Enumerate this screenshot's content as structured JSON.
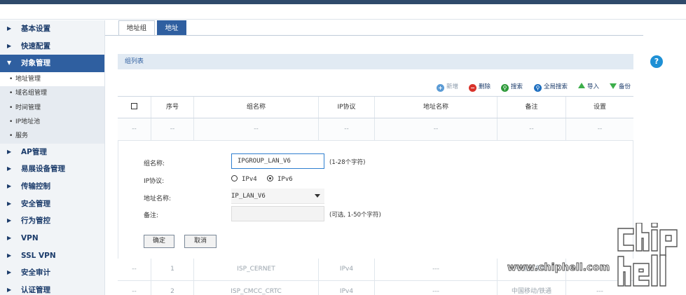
{
  "sidebar": {
    "items": [
      {
        "label": "基本设置"
      },
      {
        "label": "快速配置"
      },
      {
        "label": "对象管理",
        "active": true
      },
      {
        "label": "AP管理"
      },
      {
        "label": "易展设备管理"
      },
      {
        "label": "传输控制"
      },
      {
        "label": "安全管理"
      },
      {
        "label": "行为管控"
      },
      {
        "label": "VPN"
      },
      {
        "label": "SSL VPN"
      },
      {
        "label": "安全审计"
      },
      {
        "label": "认证管理"
      }
    ],
    "sub_items": [
      {
        "label": "地址管理",
        "active": true
      },
      {
        "label": "域名组管理"
      },
      {
        "label": "时间管理"
      },
      {
        "label": "IP地址池"
      },
      {
        "label": "服务"
      }
    ]
  },
  "tabs": [
    {
      "label": "地址组",
      "active": false
    },
    {
      "label": "地址",
      "active": true
    }
  ],
  "section_title": "组列表",
  "toolbar": {
    "add": "新增",
    "delete": "删除",
    "search": "搜索",
    "global_search": "全局搜索",
    "import": "导入",
    "backup": "备份"
  },
  "table": {
    "headers": [
      "",
      "序号",
      "组名称",
      "IP协议",
      "地址名称",
      "备注",
      "设置"
    ],
    "placeholder_row": [
      "--",
      "--",
      "--",
      "--",
      "--",
      "--",
      "--"
    ],
    "rows": [
      [
        "--",
        "1",
        "ISP_CERNET",
        "IPv4",
        "---",
        "中国教育网",
        "---"
      ],
      [
        "--",
        "2",
        "ISP_CMCC_CRTC",
        "IPv4",
        "---",
        "中国移动/铁通",
        "---"
      ]
    ]
  },
  "form": {
    "name_label": "组名称:",
    "name_value": "IPGROUP_LAN_V6",
    "name_hint": "(1-28个字符)",
    "proto_label": "IP协议:",
    "proto_options": [
      "IPv4",
      "IPv6"
    ],
    "proto_selected": "IPv6",
    "addr_label": "地址名称:",
    "addr_value": "IP_LAN_V6",
    "note_label": "备注:",
    "note_value": "",
    "note_hint": "(可选, 1-50个字符)",
    "ok_label": "确定",
    "cancel_label": "取消"
  },
  "help_label": "?",
  "watermark": {
    "text": "www.chiphell.com",
    "logo_text": "chip hell"
  },
  "colors": {
    "accent": "#2f5fa0",
    "header_band": "#e1eaf3",
    "help": "#1e90d5",
    "delete": "#d9332b",
    "search": "#2e9a3a"
  }
}
